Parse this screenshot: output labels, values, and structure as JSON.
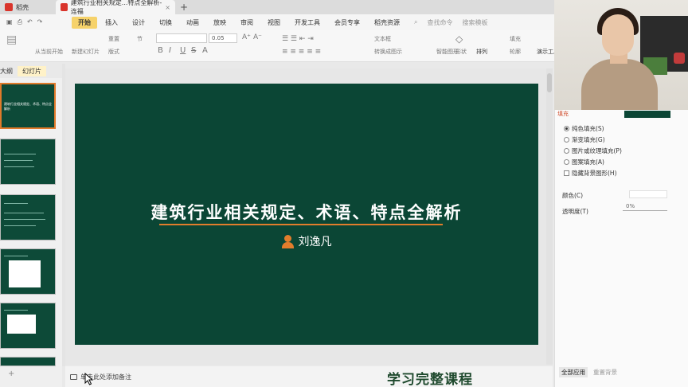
{
  "window": {
    "tabs": [
      {
        "label": "稻壳"
      },
      {
        "label": "建筑行业相关规定...特点全解析-连福"
      }
    ],
    "close_glyph": "×",
    "new_tab_glyph": "+"
  },
  "menubar": {
    "items": [
      "开始",
      "插入",
      "设计",
      "切换",
      "动画",
      "放映",
      "审阅",
      "视图",
      "开发工具",
      "会员专享",
      "稻壳资源"
    ],
    "active": "开始",
    "search_placeholder": "查找命令",
    "search_hint": "搜索模板"
  },
  "ribbon": {
    "font_size": "0.05",
    "labels": {
      "new_slide": "新建幻灯片",
      "layout": "版式",
      "reset": "重置",
      "section": "节",
      "from_current": "从当前开始",
      "text_box": "文本框",
      "shape": "形状",
      "arrange": "排列",
      "outline": "轮廓",
      "fill": "填充",
      "smart_art": "转换成图示",
      "presenter": "演示工具",
      "convert": "智能图形"
    }
  },
  "left_panel": {
    "tabs": [
      "大纲",
      "幻灯片"
    ],
    "active_tab": "幻灯片",
    "thumb_title": "建筑行业相关规定、术语、特点全解析"
  },
  "slide": {
    "title": "建筑行业相关规定、术语、特点全解析",
    "author": "刘逸凡",
    "author_icon": "person-icon",
    "background": "#0b4635",
    "accent": "#e27d2c"
  },
  "notes": {
    "placeholder": "单击此处添加备注"
  },
  "promo_text": "学习完整课程",
  "right_pane": {
    "section": "填充",
    "fill_options": [
      {
        "label": "纯色填充(S)",
        "checked": true
      },
      {
        "label": "渐变填充(G)",
        "checked": false
      },
      {
        "label": "图片或纹理填充(P)",
        "checked": false
      },
      {
        "label": "图案填充(A)",
        "checked": false
      }
    ],
    "hide_bg_label": "隐藏背景图形(H)",
    "color_label": "颜色(C)",
    "transparency_label": "透明度(T)",
    "transparency_value": "0%",
    "apply_all": "全部应用",
    "reset_bg": "重置背景"
  },
  "left_status": "+"
}
